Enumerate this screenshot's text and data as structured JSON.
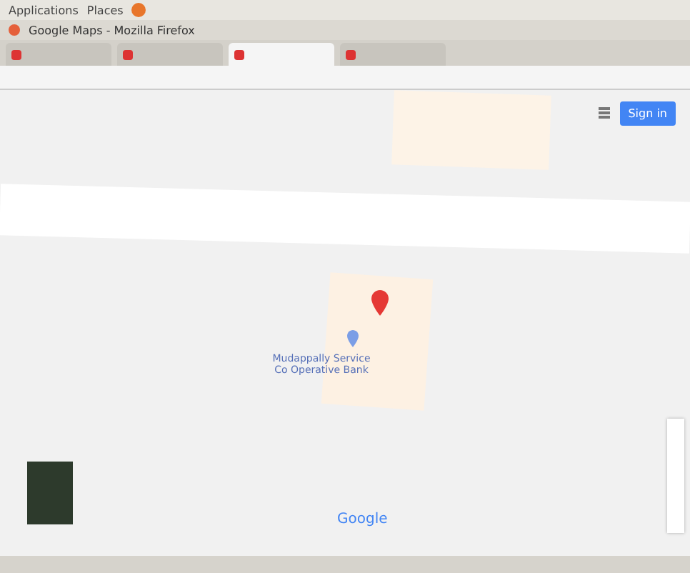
{
  "top_panel": {
    "menus": [
      "Applications",
      "Places"
    ]
  },
  "window": {
    "title": "Google Maps - Mozilla Firefox"
  },
  "tabs": [
    {
      "selected": false
    },
    {
      "selected": false
    },
    {
      "selected": true
    },
    {
      "selected": false
    }
  ],
  "map": {
    "sign_in": "Sign in",
    "place_name": "Mudappally Service Co Operative Bank",
    "logo": "Google"
  }
}
